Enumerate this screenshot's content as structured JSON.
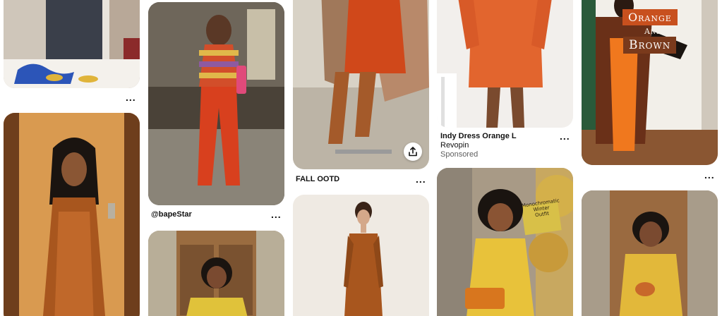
{
  "pins": [
    {
      "id": "pin-col1-top",
      "caption": "",
      "more": "..."
    },
    {
      "id": "pin-col2-top",
      "caption": "@bapeStar",
      "more": "..."
    },
    {
      "id": "pin-col3-top",
      "caption": "FALL OOTD",
      "more": "..."
    },
    {
      "id": "pin-col4-top",
      "title": "Indy Dress Orange L",
      "subtitle": "Revopin",
      "sponsored": "Sponsored",
      "more": "..."
    },
    {
      "id": "pin-col5-top",
      "overlay": {
        "line1": "Orange",
        "line2": "And",
        "line3": "Brown"
      },
      "more": "..."
    }
  ],
  "sign_text": {
    "line1": "Monochromatic",
    "line2": "Winter",
    "line3": "Outfit"
  },
  "colors": {
    "accent_orange": "#c85a1e",
    "overlay_bg": "#c8501e",
    "overlay_bg2": "#7a3a1c"
  }
}
